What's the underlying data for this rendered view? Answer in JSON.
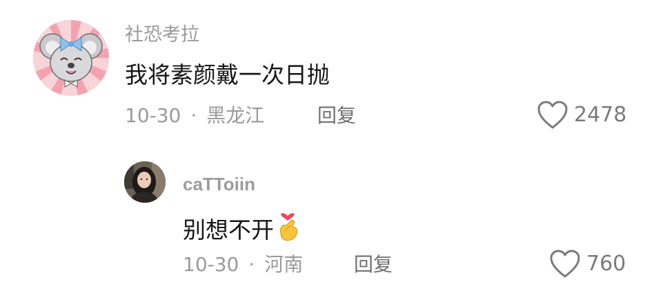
{
  "comments": [
    {
      "username": "社恐考拉",
      "text": "我将素颜戴一次日抛",
      "date": "10-30",
      "separator": "·",
      "location": "黑龙江",
      "reply_label": "回复",
      "like_count": "2478",
      "like_icon": "heart-outline-icon",
      "avatar": "koala-cartoon-avatar"
    },
    {
      "username": "caTToiin",
      "text": "别想不开",
      "emoji": "finger-heart-emoji",
      "date": "10-30",
      "separator": "·",
      "location": "河南",
      "reply_label": "回复",
      "like_count": "760",
      "like_icon": "heart-outline-icon",
      "avatar": "person-photo-avatar"
    }
  ],
  "colors": {
    "text_primary": "#161616",
    "text_secondary": "#9a9a9a",
    "reply": "#6f6f6f",
    "heart_stroke": "#7a7a7a",
    "avatar_pink": "#f6b3bd",
    "emoji_heart": "#f0465a",
    "emoji_hand": "#f7c53b"
  }
}
